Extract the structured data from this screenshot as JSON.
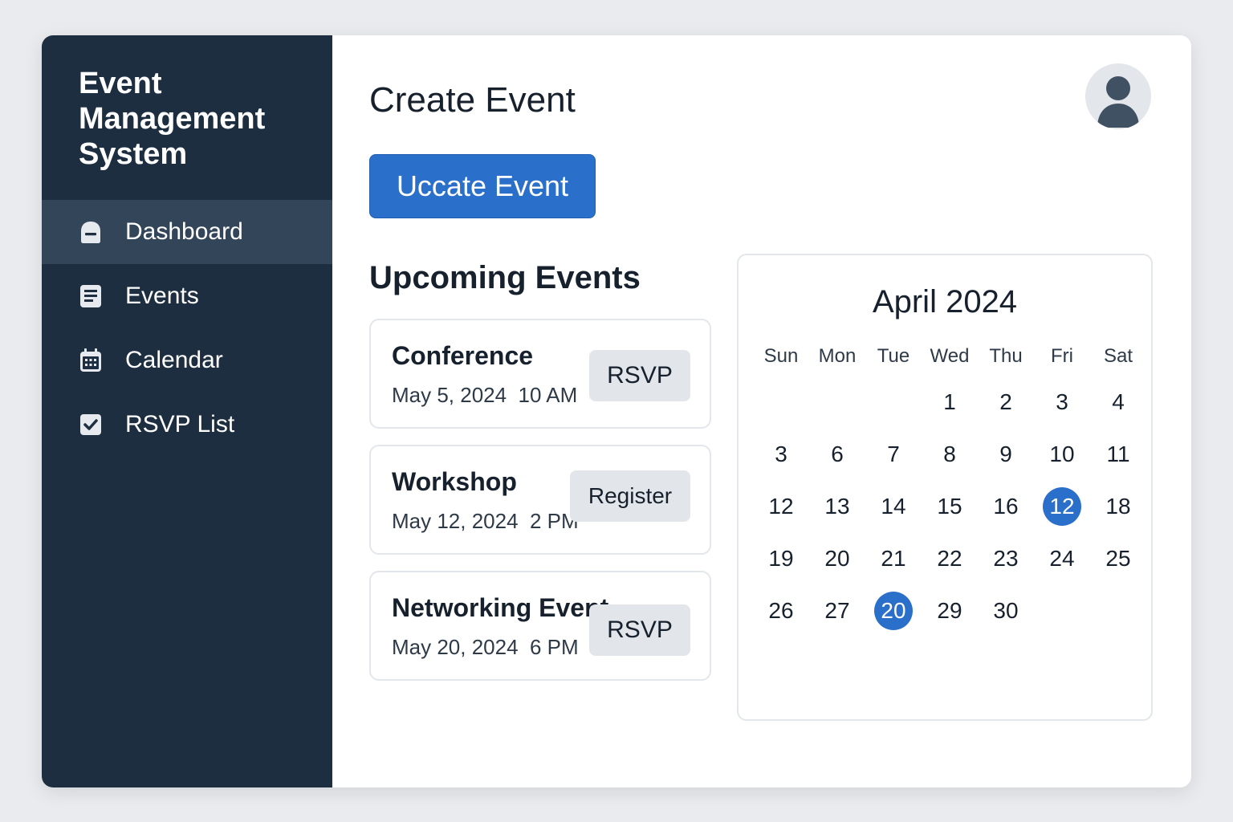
{
  "app": {
    "title": "Event Management System"
  },
  "sidebar": {
    "items": [
      {
        "label": "Dashboard",
        "icon": "dashboard-icon",
        "active": true
      },
      {
        "label": "Events",
        "icon": "events-list-icon",
        "active": false
      },
      {
        "label": "Calendar",
        "icon": "calendar-icon",
        "active": false
      },
      {
        "label": "RSVP List",
        "icon": "checkbox-icon",
        "active": false
      }
    ]
  },
  "header": {
    "title": "Create Event",
    "avatar_icon": "user-avatar-icon"
  },
  "primary_action": {
    "label": "Uccate Event"
  },
  "upcoming": {
    "title": "Upcoming Events",
    "events": [
      {
        "name": "Conference",
        "date": "May 5, 2024  10 AM",
        "action": "RSVP"
      },
      {
        "name": "Workshop",
        "date": "May 12, 2024  2 PM",
        "action": "Register"
      },
      {
        "name": "Networking Event",
        "date": "May 20, 2024  6 PM",
        "action": "RSVP"
      }
    ]
  },
  "calendar": {
    "title": "April 2024",
    "weekdays": [
      "Sun",
      "Mon",
      "Tue",
      "Wed",
      "Thu",
      "Fri",
      "Sat"
    ],
    "weeks": [
      [
        "",
        "",
        "",
        "1",
        "2",
        "3",
        "4"
      ],
      [
        "3",
        "6",
        "7",
        "8",
        "9",
        "10",
        "11"
      ],
      [
        "12",
        "13",
        "14",
        "15",
        "16",
        "12",
        "18"
      ],
      [
        "19",
        "20",
        "21",
        "22",
        "23",
        "24",
        "25"
      ],
      [
        "26",
        "27",
        "20",
        "29",
        "30",
        "",
        ""
      ]
    ],
    "selected_cells": [
      [
        2,
        5
      ],
      [
        4,
        2
      ]
    ]
  },
  "colors": {
    "sidebar_bg": "#1d2e40",
    "sidebar_active_bg": "#334558",
    "accent": "#2a6fc9",
    "secondary_button_bg": "#e2e5e9"
  }
}
